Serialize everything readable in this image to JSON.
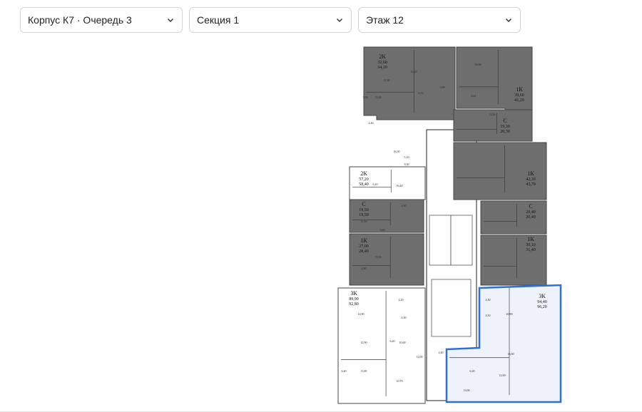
{
  "filters": {
    "building": {
      "value": "Корпус К7 · Очередь 3",
      "icon": "chevron-down-icon"
    },
    "section": {
      "value": "Секция 1",
      "icon": "chevron-down-icon"
    },
    "floor": {
      "value": "Этаж 12",
      "icon": "chevron-down-icon"
    }
  },
  "colors": {
    "sold": "#6e6e6e",
    "available": "#ffffff",
    "selected_fill": "#eef3fb",
    "selected_border": "#2f6fd6",
    "wall": "#444444"
  },
  "floor_plan": {
    "apartments": [
      {
        "id": "a1",
        "type": "2К",
        "area_1": "32,60",
        "area_2": "34,10",
        "status": "sold"
      },
      {
        "id": "a2",
        "type": "1К",
        "area_1": "39,60",
        "area_2": "41,20",
        "status": "sold"
      },
      {
        "id": "a3",
        "type": "С",
        "area_1": "19,30",
        "area_2": "20,30",
        "status": "sold"
      },
      {
        "id": "a4",
        "type": "2К",
        "area_1": "57,20",
        "area_2": "58,40",
        "status": "available"
      },
      {
        "id": "a5",
        "type": "1К",
        "area_1": "42,30",
        "area_2": "43,70",
        "status": "sold"
      },
      {
        "id": "a6",
        "type": "С",
        "area_1": "19,50",
        "area_2": "19,50",
        "status": "sold"
      },
      {
        "id": "a7",
        "type": "С",
        "area_1": "20,40",
        "area_2": "20,40",
        "status": "sold"
      },
      {
        "id": "a8",
        "type": "1К",
        "area_1": "27,00",
        "area_2": "28,40",
        "status": "sold"
      },
      {
        "id": "a9",
        "type": "1К",
        "area_1": "30,10",
        "area_2": "31,40",
        "status": "sold"
      },
      {
        "id": "a10",
        "type": "3К",
        "area_1": "89,90",
        "area_2": "92,80",
        "status": "available"
      },
      {
        "id": "a11",
        "type": "3К",
        "area_1": "94,40",
        "area_2": "96,20",
        "status": "selected"
      }
    ],
    "room_labels": [
      "11,60",
      "16,20",
      "15,30",
      "3,00",
      "6,70",
      "3,90",
      "16,00",
      "6,41",
      "12,50",
      "2,40",
      "16,30",
      "5,10",
      "9,30",
      "6,10",
      "16,40",
      "2,50",
      "11,50",
      "3,60",
      "15,50",
      "2,80",
      "4,20",
      "6,30",
      "12,00",
      "14,90",
      "12,90",
      "6,20",
      "10,60",
      "6,40",
      "11,00",
      "10,70",
      "4,30",
      "20,90",
      "4,50",
      "14,00",
      "12,00",
      "6,20",
      "13,00",
      "2,40"
    ]
  }
}
